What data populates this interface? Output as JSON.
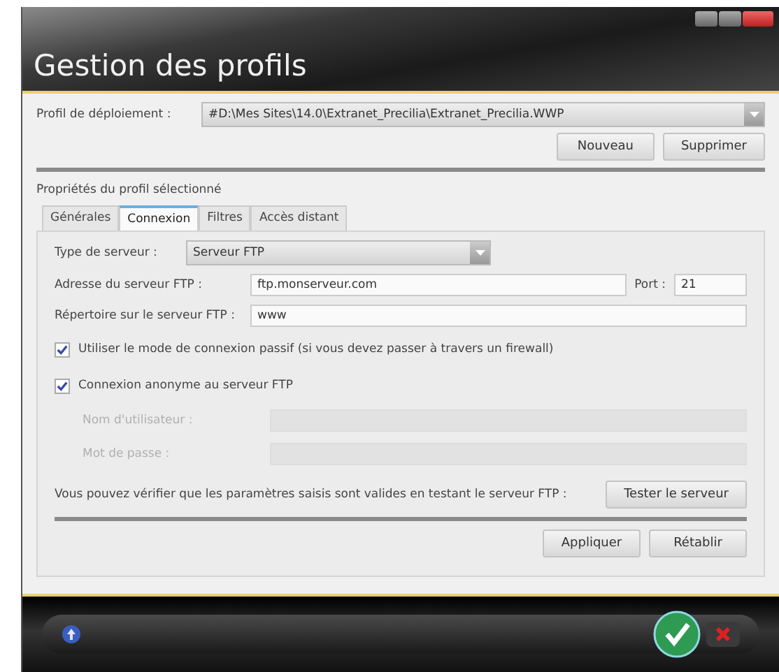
{
  "window": {
    "title": "Gestion des profils"
  },
  "profile": {
    "label": "Profil de déploiement :",
    "value": "#D:\\Mes Sites\\14.0\\Extranet_Precilia\\Extranet_Precilia.WWP"
  },
  "profile_buttons": [
    "Nouveau",
    "Supprimer"
  ],
  "section_title": "Propriétés du profil sélectionné",
  "tabs": [
    {
      "label": "Générales",
      "selected": false
    },
    {
      "label": "Connexion",
      "selected": true
    },
    {
      "label": "Filtres",
      "selected": false
    },
    {
      "label": "Accès distant",
      "selected": false
    }
  ],
  "server_type": {
    "label": "Type de serveur :",
    "value": "Serveur FTP"
  },
  "address": {
    "label": "Adresse du serveur FTP :",
    "value": "ftp.monserveur.com"
  },
  "port": {
    "label": "Port :",
    "value": "21"
  },
  "directory": {
    "label": "Répertoire sur le serveur FTP :",
    "value": "www"
  },
  "checkboxes": [
    {
      "label": "Utiliser le mode de connexion passif (si vous devez passer à travers un firewall)",
      "checked": true
    },
    {
      "label": "Connexion anonyme au serveur FTP",
      "checked": true
    }
  ],
  "credentials": [
    {
      "label": "Nom d'utilisateur :",
      "disabled": true
    },
    {
      "label": "Mot de passe :",
      "disabled": true
    }
  ],
  "test": {
    "text": "Vous pouvez vérifier que les paramètres saisis sont valides en testant le serveur FTP :",
    "button": "Tester le serveur"
  },
  "footer_buttons": [
    "Appliquer",
    "Rétablir"
  ]
}
